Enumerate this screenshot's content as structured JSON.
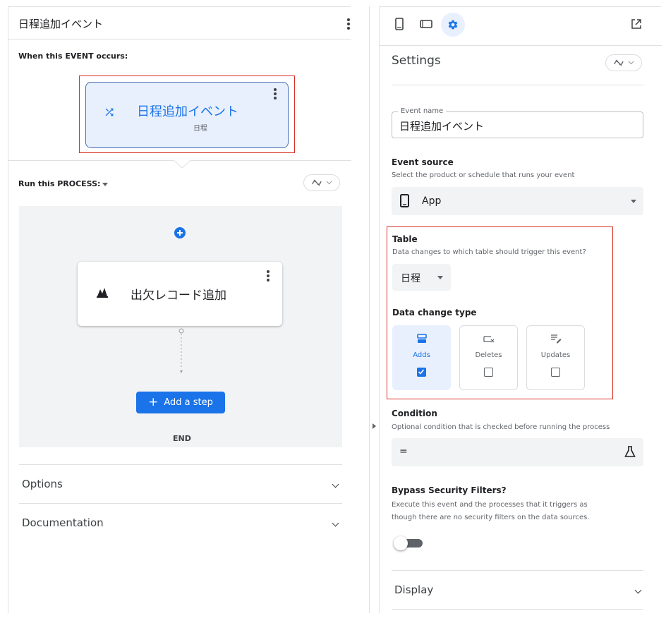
{
  "left": {
    "title": "日程追加イベント",
    "when_label": "When this EVENT occurs:",
    "event_card": {
      "title": "日程追加イベント",
      "subtitle": "日程"
    },
    "run_label": "Run this PROCESS:",
    "step_card": {
      "title": "出欠レコード追加"
    },
    "add_step_label": "Add a step",
    "end_label": "END",
    "options_label": "Options",
    "documentation_label": "Documentation"
  },
  "right": {
    "tabs": [
      "phone-icon",
      "tablet-icon",
      "gear-icon"
    ],
    "settings_title": "Settings",
    "event_name": {
      "label": "Event name",
      "value": "日程追加イベント"
    },
    "event_source": {
      "title": "Event source",
      "desc": "Select the product or schedule that runs your event",
      "value": "App"
    },
    "table": {
      "title": "Table",
      "desc": "Data changes to which table should trigger this event?",
      "value": "日程"
    },
    "data_change": {
      "title": "Data change type",
      "types": [
        {
          "label": "Adds",
          "checked": true
        },
        {
          "label": "Deletes",
          "checked": false
        },
        {
          "label": "Updates",
          "checked": false
        }
      ]
    },
    "condition": {
      "title": "Condition",
      "desc": "Optional condition that is checked before running the process",
      "value": "="
    },
    "bypass": {
      "title": "Bypass Security Filters?",
      "desc_line1": "Execute this event and the processes that it triggers as",
      "desc_line2": "though there are no security filters on the data sources.",
      "enabled": false
    },
    "display_label": "Display"
  },
  "colors": {
    "accent": "#1a73e8",
    "highlight_border": "#d93025",
    "card_bg": "#e8f0fe",
    "process_bg": "#f1f3f4"
  }
}
